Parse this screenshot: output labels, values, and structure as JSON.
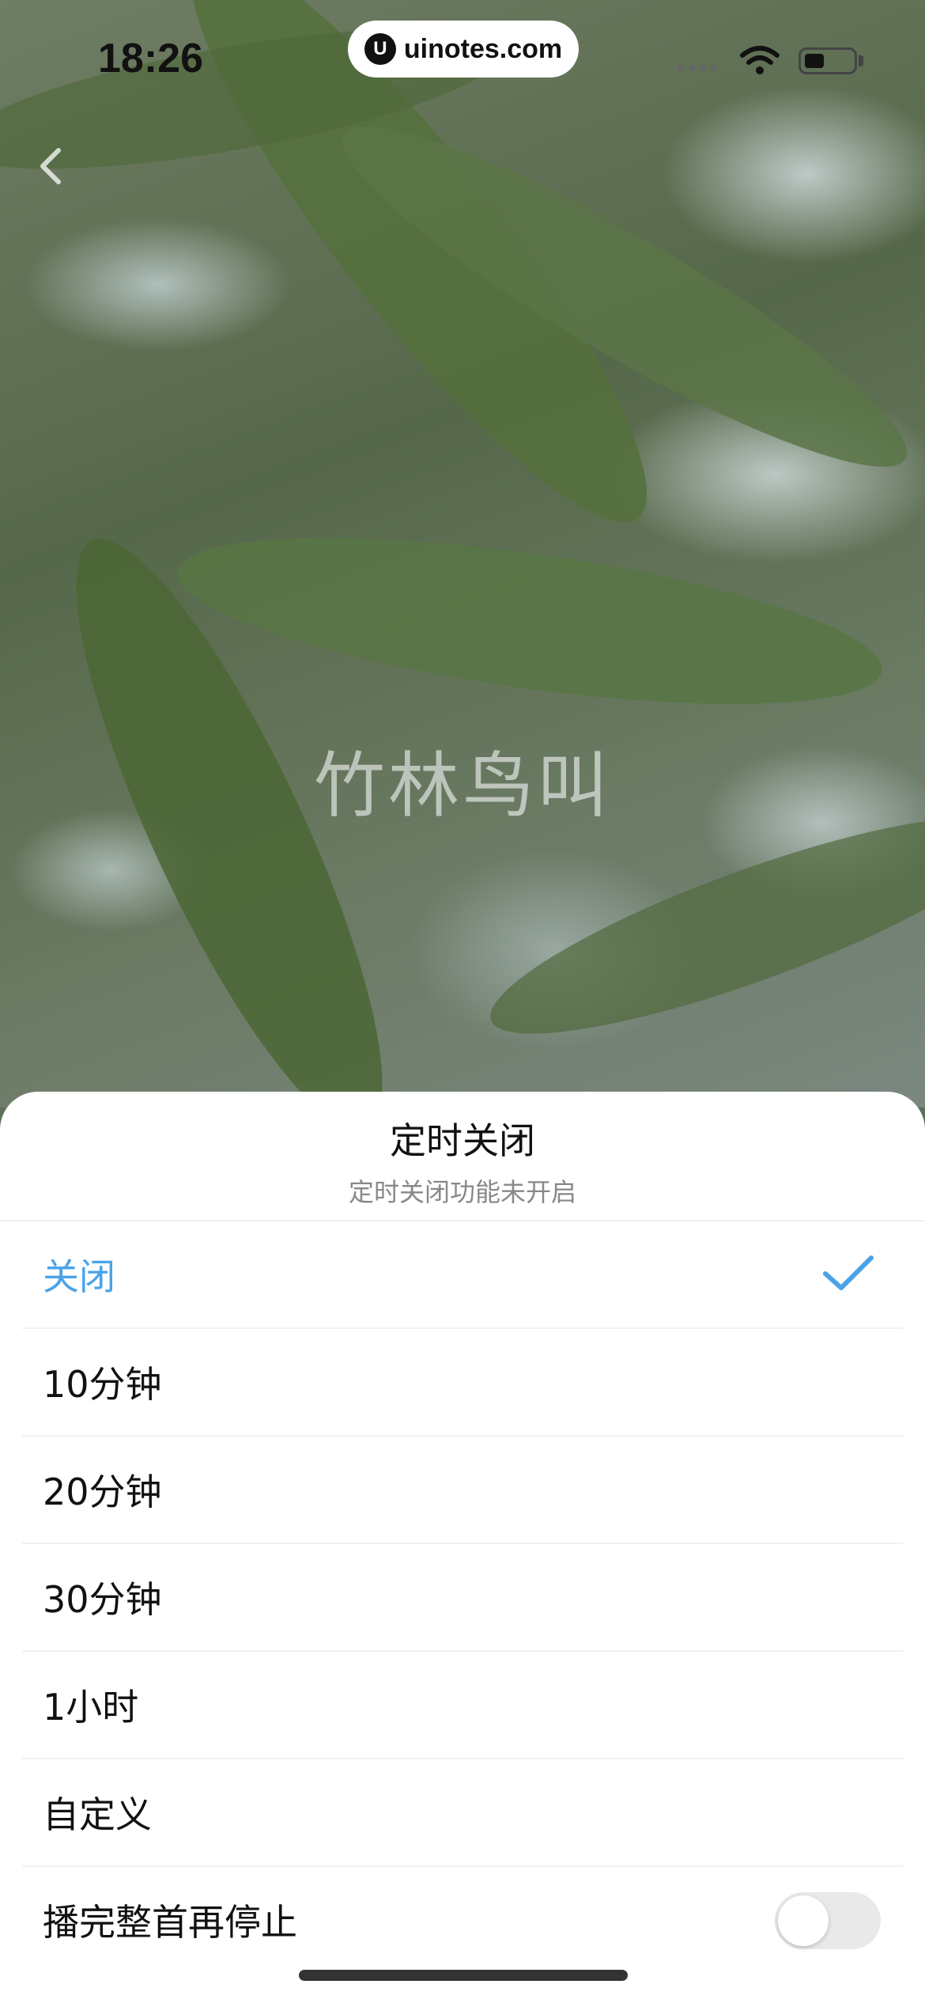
{
  "status_bar": {
    "time": "18:26",
    "watermark_logo": "U",
    "watermark_text": "uinotes.com"
  },
  "player": {
    "track_title": "竹林鸟叫"
  },
  "sheet": {
    "title": "定时关闭",
    "subtitle": "定时关闭功能未开启",
    "options": [
      {
        "label": "关闭",
        "selected": true
      },
      {
        "label": "10分钟",
        "selected": false
      },
      {
        "label": "20分钟",
        "selected": false
      },
      {
        "label": "30分钟",
        "selected": false
      },
      {
        "label": "1小时",
        "selected": false
      },
      {
        "label": "自定义",
        "selected": false
      }
    ],
    "stop_after_track_label": "播完整首再停止",
    "stop_after_track_enabled": false
  },
  "colors": {
    "accent": "#4aa3e8",
    "toggle_off": "#e9e9ea"
  },
  "icons": [
    "back-arrow-icon",
    "check-icon",
    "wifi-icon",
    "battery-icon",
    "signal-icon"
  ]
}
